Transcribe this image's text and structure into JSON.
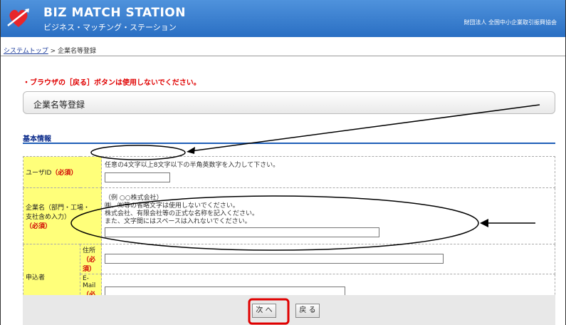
{
  "header": {
    "title": "BIZ MATCH STATION",
    "subtitle": "ビジネス・マッチング・ステーション",
    "org": "財団法人 全国中小企業取引振興協会",
    "brand_color": "#2a6fc3",
    "logo_icon": "heart-arrow-logo"
  },
  "breadcrumb": {
    "home": "システムトップ",
    "sep": " > ",
    "current": "企業名等登録"
  },
  "warning": "・ブラウザの［戻る］ボタンは使用しないでください。",
  "page_title": "企業名等登録",
  "section": "基本情報",
  "form": {
    "userid": {
      "label": "ユーザID",
      "req": "（必須）",
      "hint": "任意の4文字以上8文字以下の半角英数字を入力して下さい。",
      "value": ""
    },
    "company": {
      "label1": "企業名（部門・工場・",
      "label2": "支社含め入力）",
      "req": "（必須）",
      "hint1": "（例 ○○株式会社）",
      "hint2": "㈱、㈲等の省略文字は使用しないでください。",
      "hint3": "株式会社、有限会社等の正式な名称を記入ください。",
      "hint4": "また、文字間にはスペースは入れないでください。",
      "value": ""
    },
    "applicant": {
      "label": "申込者",
      "address_label": "住所",
      "address_req": "（必須）",
      "email_label": "E-Mail",
      "email_req": "（必須）",
      "address_value": "",
      "email_value": ""
    }
  },
  "buttons": {
    "next": "次 へ",
    "back": "戻 る"
  },
  "colors": {
    "required": "#d00000",
    "label_bg": "#ffff7a",
    "highlight": "#e00000"
  }
}
